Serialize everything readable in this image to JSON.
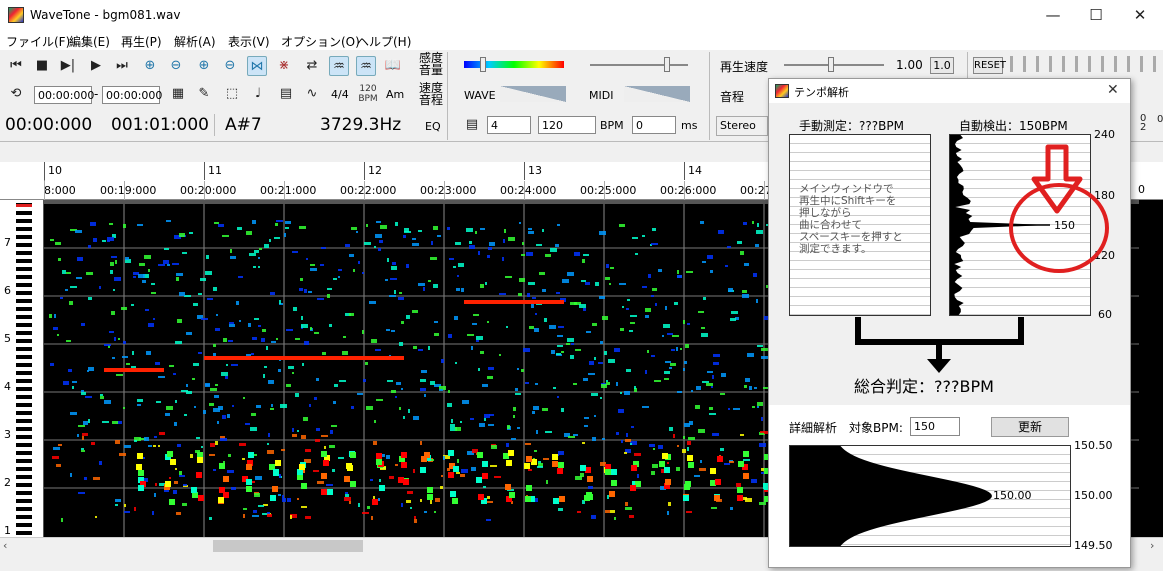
{
  "window": {
    "title": "WaveTone - bgm081.wav",
    "min": "—",
    "max": "☐",
    "close": "✕"
  },
  "menu": [
    "ファイル(F)",
    "編集(E)",
    "再生(P)",
    "解析(A)",
    "表示(V)",
    "オプション(O)",
    "ヘルプ(H)"
  ],
  "toolbar": {
    "sensitivity": "感度",
    "volume": "音量",
    "speed": "速度",
    "tone": "音程",
    "playspeed_label": "再生速度",
    "playspeed_value": "1.00",
    "playspeed_btn": "1.0",
    "reset": "RESET",
    "tone_label": "音程",
    "wave_label": "WAVE",
    "midi_label": "MIDI",
    "range_start": "00:00:000",
    "range_dash": "-",
    "range_end": "00:00:000",
    "beat_label": "4/4",
    "bpm_icon_top": "120",
    "bpm_icon_bottom": "BPM",
    "key_label": "Am",
    "eq": "EQ",
    "beats_value": "4",
    "bpm_value": "120",
    "bpm_unit": "BPM",
    "ms_value": "0",
    "ms_unit": "ms",
    "stereo": "Stereo"
  },
  "status_row": {
    "time": "00:00:000",
    "measure": "001:01:000",
    "note": "A#7",
    "freq": "3729.3Hz"
  },
  "ruler": {
    "measures": [
      "10",
      "11",
      "12",
      "13",
      "14"
    ],
    "times": [
      "8:000",
      "00:19:000",
      "00:20:000",
      "00:21:000",
      "00:22:000",
      "00:23:000",
      "00:24:000",
      "00:25:000",
      "00:26:000",
      "00:27"
    ],
    "right_measure_partial": "0"
  },
  "octaves": [
    "7",
    "6",
    "5",
    "4",
    "3",
    "2",
    "1"
  ],
  "right_edge_labels": [
    "0",
    "2",
    "0"
  ],
  "dialog": {
    "title": "テンポ解析",
    "close": "✕",
    "manual_label": "手動測定：???BPM",
    "auto_label": "自動検出：150BPM",
    "manual_help": [
      "メインウィンドウで",
      "再生中にShiftキーを",
      "押しながら",
      "曲に合わせて",
      "スペースキーを押すと",
      "測定できます。"
    ],
    "auto_axis": [
      "240",
      "180",
      "150",
      "120",
      "60"
    ],
    "auto_peak_label": "150",
    "overall_label": "総合判定：???BPM",
    "detail_label": "詳細解析",
    "target_label": "対象BPM:",
    "target_value": "150",
    "update_btn": "更新",
    "detail_axis": [
      "150.50",
      "150.00",
      "149.50"
    ],
    "detail_peak_label": "150.00"
  },
  "colors": {
    "accent_red": "#e02020",
    "spectro_bg": "#000000"
  }
}
